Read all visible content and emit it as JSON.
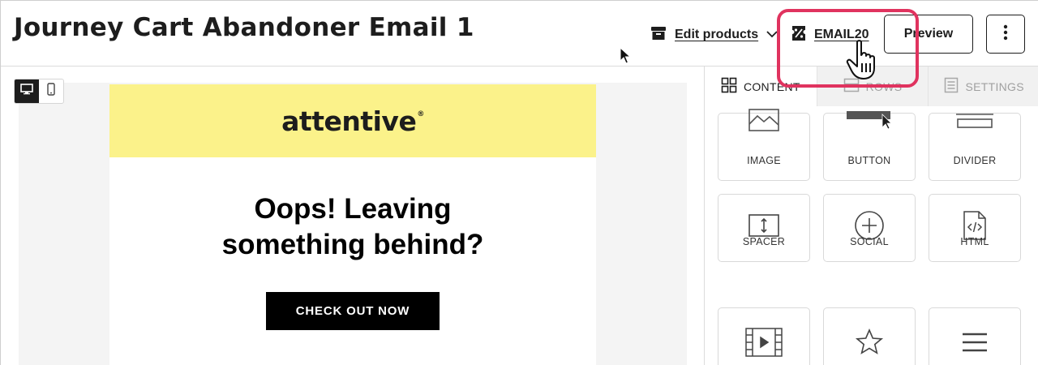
{
  "header": {
    "title": "Journey Cart Abandoner Email 1",
    "edit_products_label": "Edit products",
    "coupon_label": "EMAIL20",
    "preview_label": "Preview"
  },
  "icons": {
    "edit_products": "box-icon",
    "edit_products_dropdown": "chevron-down-icon",
    "coupon": "coupon-icon",
    "more": "more-vertical-icon",
    "desktop": "desktop-icon",
    "mobile": "mobile-icon"
  },
  "colors": {
    "highlight": "#e0335f",
    "banner": "#fbf28a",
    "cta_bg": "#000000",
    "canvas_bg": "#f4f4f4"
  },
  "device_toggle": {
    "selected": "desktop"
  },
  "email": {
    "logo_text": "attentive",
    "logo_mark": "®",
    "headline_line1": "Oops! Leaving",
    "headline_line2": "something behind?",
    "cta_label": "CHECK OUT NOW"
  },
  "panel": {
    "tabs": [
      {
        "label": "CONTENT",
        "icon": "grid-icon",
        "active": true
      },
      {
        "label": "ROWS",
        "icon": "rows-icon",
        "active": false
      },
      {
        "label": "SETTINGS",
        "icon": "settings-doc-icon",
        "active": false
      }
    ],
    "tiles": [
      {
        "label": "IMAGE",
        "icon": "image-icon"
      },
      {
        "label": "BUTTON",
        "icon": "button-icon"
      },
      {
        "label": "DIVIDER",
        "icon": "divider-icon"
      },
      {
        "label": "SPACER",
        "icon": "spacer-icon"
      },
      {
        "label": "SOCIAL",
        "icon": "social-icon"
      },
      {
        "label": "HTML",
        "icon": "html-icon"
      },
      {
        "label": "",
        "icon": "video-icon"
      },
      {
        "label": "",
        "icon": "star-icon"
      },
      {
        "label": "",
        "icon": "menu-icon"
      }
    ]
  }
}
